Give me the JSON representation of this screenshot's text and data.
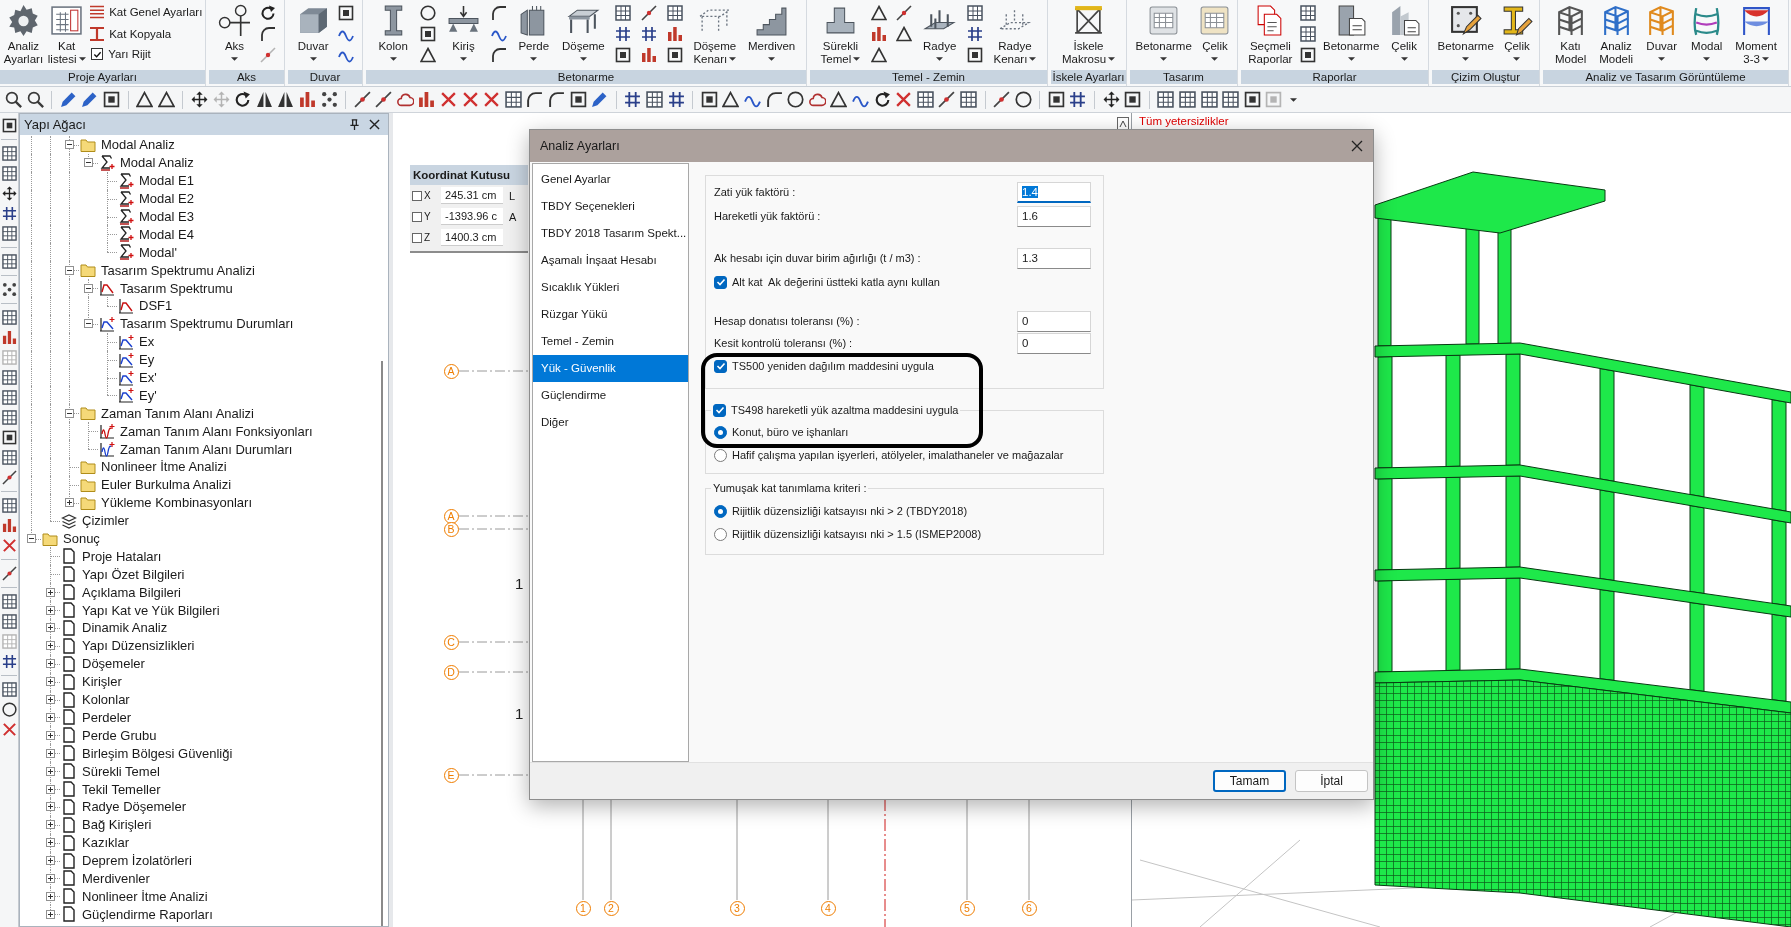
{
  "ribbon": {
    "groups": [
      {
        "label": "Proje Ayarları",
        "items": [
          {
            "kind": "large",
            "lines": [
              "Analiz",
              "Ayarları"
            ],
            "dropdown": false
          },
          {
            "kind": "large",
            "lines": [
              "Kat",
              "listesi"
            ],
            "dropdown": true
          },
          {
            "kind": "list",
            "entries": [
              {
                "kind": "command",
                "label": "Kat Genel Ayarları"
              },
              {
                "kind": "command",
                "label": "Kat Kopyala"
              },
              {
                "kind": "check",
                "label": "Yarı Rijit",
                "checked": true
              }
            ]
          }
        ]
      },
      {
        "label": "Aks",
        "items": [
          {
            "kind": "large",
            "lines": [
              "Aks"
            ],
            "dropdown": true
          },
          {
            "kind": "tools",
            "tools": [
              {
                "disabled": false
              },
              {
                "disabled": false
              },
              {
                "disabled": true
              }
            ]
          }
        ]
      },
      {
        "label": "Duvar",
        "items": [
          {
            "kind": "large",
            "lines": [
              "Duvar"
            ],
            "dropdown": true
          },
          {
            "kind": "tools",
            "tools": [
              {
                "disabled": false
              },
              {
                "disabled": false
              },
              {
                "disabled": false
              }
            ]
          }
        ]
      },
      {
        "label": "Betonarme",
        "items": [
          {
            "kind": "large",
            "lines": [
              "Kolon"
            ],
            "dropdown": true
          },
          {
            "kind": "tools",
            "tools": [
              {
                "disabled": false
              },
              {
                "disabled": false
              },
              {
                "disabled": false
              }
            ]
          },
          {
            "kind": "large",
            "lines": [
              "Kiriş"
            ],
            "dropdown": true
          },
          {
            "kind": "tools",
            "tools": [
              {
                "disabled": false
              },
              {
                "disabled": false
              },
              {
                "disabled": false
              }
            ]
          },
          {
            "kind": "large",
            "lines": [
              "Perde"
            ],
            "dropdown": true
          },
          {
            "kind": "large",
            "lines": [
              "Döşeme"
            ],
            "dropdown": true
          },
          {
            "kind": "tools",
            "tools": [
              {
                "disabled": false
              },
              {
                "disabled": false
              },
              {
                "disabled": false
              }
            ]
          },
          {
            "kind": "tools",
            "tools": [
              {
                "disabled": false
              },
              {
                "disabled": false
              },
              {
                "disabled": false
              }
            ]
          },
          {
            "kind": "tools",
            "tools": [
              {
                "disabled": false
              },
              {
                "disabled": false
              },
              {
                "disabled": false
              }
            ]
          },
          {
            "kind": "large",
            "lines": [
              "Döşeme",
              "Kenarı"
            ],
            "dropdown": true
          },
          {
            "kind": "large",
            "lines": [
              "Merdiven"
            ],
            "dropdown": true
          }
        ]
      },
      {
        "label": "Temel - Zemin",
        "items": [
          {
            "kind": "large",
            "lines": [
              "Sürekli",
              "Temel"
            ],
            "dropdown": true
          },
          {
            "kind": "tools",
            "tools": [
              {
                "disabled": false
              },
              {
                "disabled": false
              },
              {
                "disabled": false
              }
            ]
          },
          {
            "kind": "tools",
            "tools": [
              {
                "disabled": false
              },
              {
                "disabled": false
              }
            ]
          },
          {
            "kind": "large",
            "lines": [
              "Radye"
            ],
            "dropdown": true
          },
          {
            "kind": "tools",
            "tools": [
              {
                "disabled": false
              },
              {
                "disabled": false
              },
              {
                "disabled": false
              }
            ]
          },
          {
            "kind": "large",
            "lines": [
              "Radye",
              "Kenarı"
            ],
            "dropdown": true
          }
        ]
      },
      {
        "label": "İskele Ayarları",
        "items": [
          {
            "kind": "large",
            "lines": [
              "İskele",
              "Makrosu"
            ],
            "dropdown": true
          }
        ]
      },
      {
        "label": "Tasarım",
        "items": [
          {
            "kind": "large",
            "lines": [
              "Betonarme"
            ],
            "dropdown": true
          },
          {
            "kind": "large",
            "lines": [
              "Çelik"
            ],
            "dropdown": true
          }
        ]
      },
      {
        "label": "Raporlar",
        "items": [
          {
            "kind": "large",
            "lines": [
              "Seçmeli",
              "Raporlar"
            ],
            "dropdown": false
          },
          {
            "kind": "tools",
            "tools": [
              {
                "disabled": false
              },
              {
                "disabled": false
              },
              {
                "disabled": false
              }
            ]
          },
          {
            "kind": "large",
            "lines": [
              "Betonarme"
            ],
            "dropdown": true
          },
          {
            "kind": "large",
            "lines": [
              "Çelik"
            ],
            "dropdown": true
          }
        ]
      },
      {
        "label": "Çizim Oluştur",
        "items": [
          {
            "kind": "large",
            "lines": [
              "Betonarme"
            ],
            "dropdown": true
          },
          {
            "kind": "large",
            "lines": [
              "Çelik"
            ],
            "dropdown": true
          }
        ]
      },
      {
        "label": "Analiz ve Tasarım Görüntüleme",
        "items": [
          {
            "kind": "large",
            "lines": [
              "Katı",
              "Model"
            ],
            "dropdown": false
          },
          {
            "kind": "large",
            "lines": [
              "Analiz",
              "Modeli"
            ],
            "dropdown": false
          },
          {
            "kind": "large",
            "lines": [
              "Duvar"
            ],
            "dropdown": true
          },
          {
            "kind": "large",
            "lines": [
              "Modal"
            ],
            "dropdown": true
          },
          {
            "kind": "large",
            "lines": [
              "Moment",
              "3-3"
            ],
            "dropdown": true
          }
        ]
      }
    ]
  },
  "toolbar": {
    "groups": [
      {
        "tools": [
          {
            "disabled": false
          },
          {
            "disabled": false
          }
        ]
      },
      {
        "tools": [
          {
            "disabled": false
          },
          {
            "disabled": false
          },
          {
            "disabled": false
          }
        ]
      },
      {
        "tools": [
          {
            "disabled": false
          },
          {
            "disabled": false
          }
        ]
      },
      {
        "tools": [
          {
            "disabled": false
          },
          {
            "disabled": true
          },
          {
            "disabled": false
          },
          {
            "disabled": false
          },
          {
            "disabled": false
          },
          {
            "disabled": false
          },
          {
            "disabled": false
          }
        ]
      },
      {
        "tools": [
          {
            "disabled": false
          },
          {
            "disabled": false
          },
          {
            "disabled": false
          },
          {
            "disabled": false
          },
          {
            "disabled": false
          },
          {
            "disabled": false
          },
          {
            "disabled": false
          },
          {
            "disabled": false
          },
          {
            "disabled": false
          },
          {
            "disabled": false
          },
          {
            "disabled": false
          },
          {
            "disabled": false
          }
        ]
      },
      {
        "tools": [
          {
            "disabled": false
          },
          {
            "disabled": false
          },
          {
            "disabled": false
          }
        ]
      },
      {
        "tools": [
          {
            "disabled": false
          },
          {
            "disabled": false
          },
          {
            "disabled": false
          },
          {
            "disabled": false
          },
          {
            "disabled": false
          },
          {
            "disabled": false
          },
          {
            "disabled": false
          },
          {
            "disabled": false
          },
          {
            "disabled": false
          },
          {
            "disabled": false
          },
          {
            "disabled": false
          },
          {
            "disabled": false
          },
          {
            "disabled": false
          }
        ]
      },
      {
        "tools": [
          {
            "disabled": false
          },
          {
            "disabled": false
          }
        ]
      },
      {
        "tools": [
          {
            "disabled": false
          },
          {
            "disabled": false
          }
        ]
      },
      {
        "tools": [
          {
            "disabled": false
          },
          {
            "disabled": false
          }
        ]
      },
      {
        "tools": [
          {
            "disabled": false
          },
          {
            "disabled": false
          },
          {
            "disabled": false
          },
          {
            "disabled": false
          },
          {
            "disabled": false
          },
          {
            "disabled": true
          }
        ]
      }
    ]
  },
  "side_toolbar": {
    "groups": [
      {
        "tools": [
          {
            "disabled": false
          }
        ]
      },
      {
        "tools": [
          {
            "disabled": false
          },
          {
            "disabled": false
          },
          {
            "disabled": false
          },
          {
            "disabled": false
          },
          {
            "disabled": false
          }
        ]
      },
      {
        "tools": [
          {
            "disabled": false
          }
        ]
      },
      {
        "tools": [
          {
            "disabled": false
          }
        ]
      },
      {
        "tools": [
          {
            "disabled": false
          },
          {
            "disabled": false
          },
          {
            "disabled": true
          },
          {
            "disabled": false
          },
          {
            "disabled": false
          },
          {
            "disabled": false
          },
          {
            "disabled": false
          },
          {
            "disabled": false
          },
          {
            "disabled": false
          }
        ]
      },
      {
        "tools": [
          {
            "disabled": false
          },
          {
            "disabled": false
          },
          {
            "disabled": false
          }
        ]
      },
      {
        "tools": [
          {
            "disabled": false
          }
        ]
      },
      {
        "tools": [
          {
            "disabled": false
          },
          {
            "disabled": false
          },
          {
            "disabled": true
          },
          {
            "disabled": false
          }
        ]
      },
      {
        "tools": [
          {
            "disabled": false
          },
          {
            "disabled": false
          },
          {
            "disabled": false
          }
        ]
      }
    ]
  },
  "tree_panel": {
    "title": "Yapı Ağacı",
    "items": [
      {
        "children": [
          {
            "children": [
              {
                "label": "Modal Analiz",
                "kind": "folder",
                "expanded": true,
                "children": [
                  {
                    "label": "Modal Analiz",
                    "kind": "sigma",
                    "expanded": true,
                    "children": [
                      {
                        "label": "Modal E1",
                        "kind": "sigma"
                      },
                      {
                        "label": "Modal E2",
                        "kind": "sigma"
                      },
                      {
                        "label": "Modal E3",
                        "kind": "sigma"
                      },
                      {
                        "label": "Modal E4",
                        "kind": "sigma"
                      },
                      {
                        "label": "Modal'",
                        "kind": "sigma"
                      }
                    ]
                  }
                ]
              },
              {
                "label": "Tasarım Spektrumu Analizi",
                "kind": "folder",
                "expanded": true,
                "children": [
                  {
                    "label": "Tasarım Spektrumu",
                    "kind": "spectrum",
                    "expanded": true,
                    "children": [
                      {
                        "label": "DSF1",
                        "kind": "spectrum"
                      }
                    ]
                  },
                  {
                    "label": "Tasarım Spektrumu Durumları",
                    "kind": "spectrum-case",
                    "expanded": true,
                    "children": [
                      {
                        "label": "Ex",
                        "kind": "spectrum-case"
                      },
                      {
                        "label": "Ey",
                        "kind": "spectrum-case"
                      },
                      {
                        "label": "Ex'",
                        "kind": "spectrum-case"
                      },
                      {
                        "label": "Ey'",
                        "kind": "spectrum-case"
                      }
                    ]
                  }
                ]
              },
              {
                "label": "Zaman Tanım Alanı Analizi",
                "kind": "folder",
                "expanded": true,
                "children": [
                  {
                    "label": "Zaman Tanım Alanı Fonksiyonları",
                    "kind": "time-function"
                  },
                  {
                    "label": "Zaman Tanım Alanı Durumları",
                    "kind": "time-case"
                  }
                ]
              },
              {
                "label": "Nonlineer İtme Analizi",
                "kind": "folder"
              },
              {
                "label": "Euler Burkulma Analizi",
                "kind": "folder"
              },
              {
                "label": "Yükleme Kombinasyonları",
                "kind": "folder",
                "expanded": false
              }
            ]
          },
          {
            "label": "Çizimler",
            "kind": "drawings"
          }
        ]
      },
      {
        "label": "Sonuç",
        "kind": "folder",
        "expanded": true,
        "children": [
          {
            "label": "Proje Hataları",
            "kind": "page"
          },
          {
            "label": "Yapı Özet Bilgileri",
            "kind": "page"
          },
          {
            "label": "Açıklama Bilgileri",
            "kind": "page",
            "expanded": false
          },
          {
            "label": "Yapı Kat ve Yük Bilgileri",
            "kind": "page",
            "expanded": false
          },
          {
            "label": "Dinamik Analiz",
            "kind": "page",
            "expanded": false
          },
          {
            "label": "Yapı Düzensizlikleri",
            "kind": "page",
            "expanded": false
          },
          {
            "label": "Döşemeler",
            "kind": "page",
            "expanded": false
          },
          {
            "label": "Kirişler",
            "kind": "page",
            "expanded": false
          },
          {
            "label": "Kolonlar",
            "kind": "page",
            "expanded": false
          },
          {
            "label": "Perdeler",
            "kind": "page",
            "expanded": false
          },
          {
            "label": "Perde Grubu",
            "kind": "page",
            "expanded": false
          },
          {
            "label": "Birleşim Bölgesi Güvenliği",
            "kind": "page",
            "expanded": false
          },
          {
            "label": "Sürekli Temel",
            "kind": "page",
            "expanded": false
          },
          {
            "label": "Tekil Temeller",
            "kind": "page",
            "expanded": false
          },
          {
            "label": "Radye Döşemeler",
            "kind": "page",
            "expanded": false
          },
          {
            "label": "Bağ Kirişleri",
            "kind": "page",
            "expanded": false
          },
          {
            "label": "Kazıklar",
            "kind": "page",
            "expanded": false
          },
          {
            "label": "Deprem İzolatörleri",
            "kind": "page",
            "expanded": false
          },
          {
            "label": "Merdivenler",
            "kind": "page",
            "expanded": false
          },
          {
            "label": "Nonlineer İtme Analizi",
            "kind": "page",
            "expanded": false
          },
          {
            "label": "Güçlendirme Raporları",
            "kind": "page",
            "expanded": false
          }
        ]
      }
    ]
  },
  "plan_view": {
    "row_axes": [
      "A",
      "A",
      "B",
      "C",
      "D",
      "E"
    ],
    "column_axes": [
      "1",
      "2",
      "3",
      "4",
      "5",
      "6"
    ],
    "dimension_numbers": [
      "1",
      "1"
    ]
  },
  "coordinate_box": {
    "title": "Koordinat Kutusu",
    "rows": [
      {
        "axis": "X",
        "checked": false,
        "value": "245.31 cm",
        "unit": "L"
      },
      {
        "axis": "Y",
        "checked": false,
        "value": "-1393.96 c",
        "unit": "A"
      },
      {
        "axis": "Z",
        "checked": false,
        "value": "1400.3 cm"
      }
    ]
  },
  "model_view": {
    "message": "Tüm yetersizlikler"
  },
  "dialog": {
    "title": "Analiz Ayarları",
    "nav": [
      {
        "label": "Genel Ayarlar",
        "selected": false
      },
      {
        "label": "TBDY Seçenekleri",
        "selected": false
      },
      {
        "label": "TBDY 2018 Tasarım Spekt...",
        "selected": false
      },
      {
        "label": "Aşamalı İnşaat Hesabı",
        "selected": false
      },
      {
        "label": "Sıcaklık Yükleri",
        "selected": false
      },
      {
        "label": "Rüzgar Yükü",
        "selected": false
      },
      {
        "label": "Temel - Zemin",
        "selected": false
      },
      {
        "label": "Yük - Güvenlik",
        "selected": true
      },
      {
        "label": "Güçlendirme",
        "selected": false
      },
      {
        "label": "Diğer",
        "selected": false
      }
    ],
    "groups": [
      {
        "kind": "plain",
        "sections": [
          [
            {
              "kind": "field",
              "label": "Zati yük faktörü :",
              "value": "1.4",
              "focused": true
            },
            {
              "kind": "field",
              "label": "Hareketli yük faktörü :",
              "value": "1.6",
              "focused": false
            }
          ],
          [
            {
              "kind": "field",
              "label": "Ak hesabı için duvar birim ağırlığı (t / m3) :",
              "value": "1.3",
              "focused": false
            },
            {
              "kind": "check",
              "label": "Alt kat  Ak değerini üstteki katla aynı kullan",
              "checked": true
            }
          ],
          [
            {
              "kind": "field",
              "label": "Hesap donatısı toleransı (%) :",
              "value": "0",
              "focused": false
            },
            {
              "kind": "field",
              "label": "Kesit kontrolü toleransı (%) :",
              "value": "0",
              "focused": false
            },
            {
              "kind": "check",
              "label": "TS500 yeniden dağılım maddesini uygula",
              "checked": true
            }
          ]
        ]
      },
      {
        "kind": "check-titled",
        "legend": {
          "label": "TS498 hareketli yük azaltma maddesini uygula",
          "checked": true
        },
        "sections": [
          [
            {
              "kind": "radio",
              "label": "Konut, büro ve işhanları",
              "selected": true
            },
            {
              "kind": "radio",
              "label": "Hafif çalışma yapılan işyerleri, atölyeler, imalathaneler ve mağazalar",
              "selected": false
            }
          ]
        ]
      },
      {
        "kind": "titled",
        "legend": {
          "label": "Yumuşak kat tanımlama kriteri :"
        },
        "sections": [
          [
            {
              "kind": "radio",
              "label": "Rijitlik düzensizliği katsayısı nki > 2 (TBDY2018)",
              "selected": true
            },
            {
              "kind": "radio",
              "label": "Rijitlik düzensizliği katsayısı nki > 1.5 (ISMEP2008)",
              "selected": false
            }
          ]
        ]
      }
    ],
    "buttons": [
      {
        "label": "Tamam",
        "default": true
      },
      {
        "label": "İptal",
        "default": false
      }
    ]
  }
}
